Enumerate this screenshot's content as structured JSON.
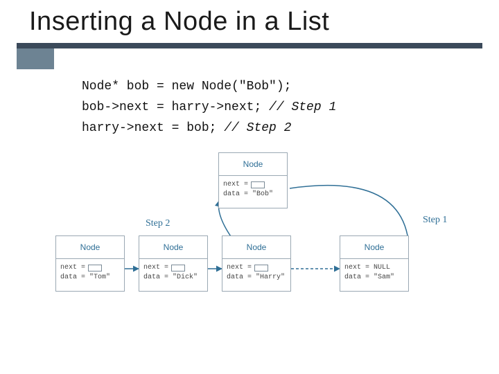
{
  "title": "Inserting a Node in a List",
  "code": {
    "line1_a": "Node* bob = new Node(\"Bob\");",
    "line2_a": "bob->next = harry->next; ",
    "line2_b": "// Step 1",
    "line3_a": "harry->next = bob; ",
    "line3_b": "// Step 2"
  },
  "labels": {
    "step1": "Step 1",
    "step2": "Step 2"
  },
  "nodes": {
    "bob": {
      "header": "Node",
      "next_lhs": "next =",
      "data": "data = \"Bob\""
    },
    "tom": {
      "header": "Node",
      "next_lhs": "next =",
      "data": "data = \"Tom\""
    },
    "dick": {
      "header": "Node",
      "next_lhs": "next =",
      "data": "data = \"Dick\""
    },
    "harry": {
      "header": "Node",
      "next_lhs": "next =",
      "data": "data = \"Harry\""
    },
    "sam": {
      "header": "Node",
      "next_lhs": "next = NULL",
      "data": "data = \"Sam\""
    }
  }
}
